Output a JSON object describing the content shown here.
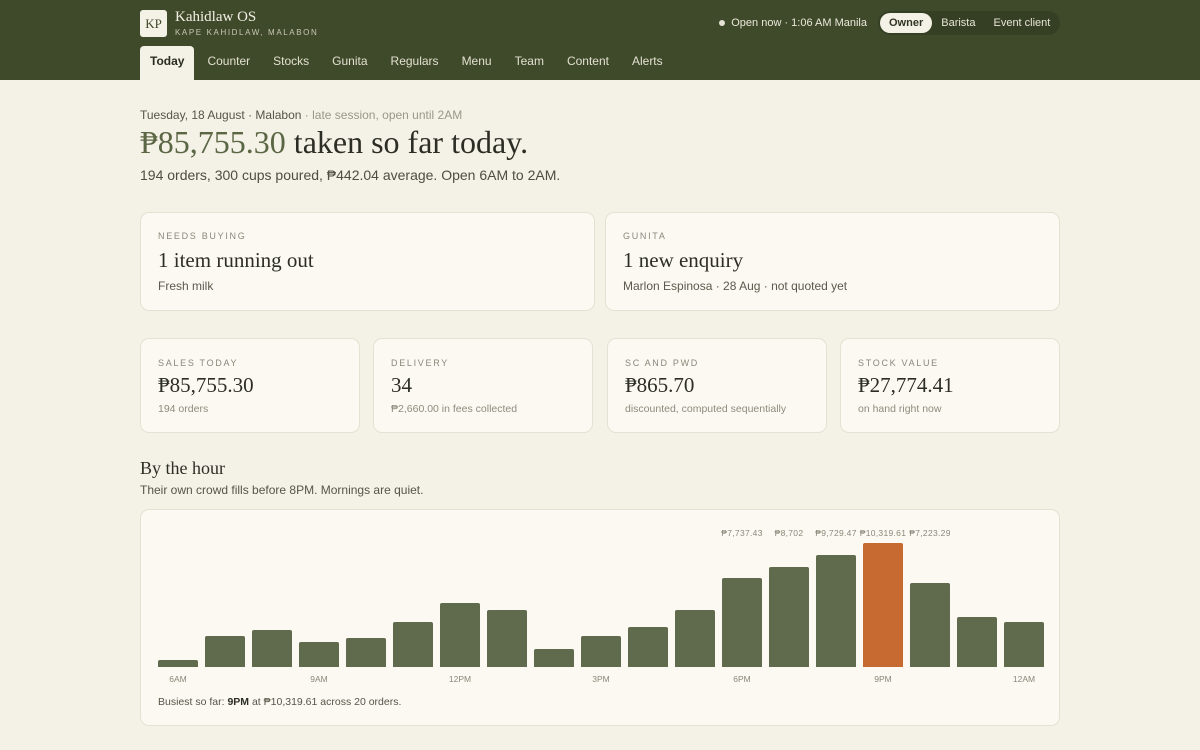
{
  "app": {
    "logo": "KP",
    "name": "Kahidlaw OS",
    "subtitle": "KAPE KAHIDLAW, MALABON"
  },
  "status": {
    "text": "Open now · 1:06 AM Manila"
  },
  "roles": [
    {
      "label": "Owner",
      "active": true
    },
    {
      "label": "Barista",
      "active": false
    },
    {
      "label": "Event client",
      "active": false
    }
  ],
  "nav": [
    {
      "label": "Today",
      "active": true
    },
    {
      "label": "Counter",
      "active": false
    },
    {
      "label": "Stocks",
      "active": false
    },
    {
      "label": "Gunita",
      "active": false
    },
    {
      "label": "Regulars",
      "active": false
    },
    {
      "label": "Menu",
      "active": false
    },
    {
      "label": "Team",
      "active": false
    },
    {
      "label": "Content",
      "active": false
    },
    {
      "label": "Alerts",
      "active": false
    }
  ],
  "summary": {
    "date": "Tuesday, 18 August · Malabon",
    "session_note": " · late session, open until 2AM",
    "amount": "₱85,755.30",
    "headline_rest": " taken so far today.",
    "detail": "194 orders, 300 cups poured, ₱442.04 average. Open 6AM to 2AM."
  },
  "alerts": {
    "needs_buying": {
      "label": "NEEDS BUYING",
      "title": "1 item running out",
      "detail": "Fresh milk"
    },
    "gunita": {
      "label": "GUNITA",
      "title": "1 new enquiry",
      "detail": "Marlon Espinosa · 28 Aug · not quoted yet"
    }
  },
  "stats": [
    {
      "label": "SALES TODAY",
      "value": "₱85,755.30",
      "note": "194 orders"
    },
    {
      "label": "DELIVERY",
      "value": "34",
      "note": "₱2,660.00 in fees collected"
    },
    {
      "label": "SC AND PWD",
      "value": "₱865.70",
      "note": "discounted, computed sequentially"
    },
    {
      "label": "STOCK VALUE",
      "value": "₱27,774.41",
      "note": "on hand right now"
    }
  ],
  "by_hour": {
    "title": "By the hour",
    "subtitle": "Their own crowd fills before 8PM. Mornings are quiet.",
    "note_prefix": "Busiest so far: ",
    "note_hour": "9PM",
    "note_suffix": " at ₱10,319.61 across 20 orders."
  },
  "colors": {
    "bar": "#606a4d",
    "peak": "#c66a31",
    "header": "#3f4a2b"
  },
  "chart_data": {
    "type": "bar",
    "categories": [
      "6AM",
      "7AM",
      "8AM",
      "9AM",
      "10AM",
      "11AM",
      "12PM",
      "1PM",
      "2PM",
      "3PM",
      "4PM",
      "5PM",
      "6PM",
      "7PM",
      "8PM",
      "9PM",
      "10PM",
      "11PM",
      "12AM"
    ],
    "values": [
      620,
      2600,
      3050,
      2050,
      2400,
      3750,
      5300,
      4750,
      1500,
      2600,
      3300,
      4750,
      7400,
      8300,
      9350,
      10319.61,
      6950,
      4150,
      3750
    ],
    "data_labels": [
      {
        "index": 12,
        "text": "₱7,737.43"
      },
      {
        "index": 13,
        "text": "₱8,702"
      },
      {
        "index": 14,
        "text": "₱9,729.47"
      },
      {
        "index": 15,
        "text": "₱10,319.61"
      },
      {
        "index": 16,
        "text": "₱7,223.29"
      }
    ],
    "tick_labels": [
      {
        "index": 0,
        "text": "6AM"
      },
      {
        "index": 3,
        "text": "9AM"
      },
      {
        "index": 6,
        "text": "12PM"
      },
      {
        "index": 9,
        "text": "3PM"
      },
      {
        "index": 12,
        "text": "6PM"
      },
      {
        "index": 15,
        "text": "9PM"
      },
      {
        "index": 18,
        "text": "12AM"
      }
    ],
    "highlight_index": 15,
    "ylim": [
      0,
      10319.61
    ],
    "grid": false,
    "title": "",
    "xlabel": "",
    "ylabel": ""
  }
}
